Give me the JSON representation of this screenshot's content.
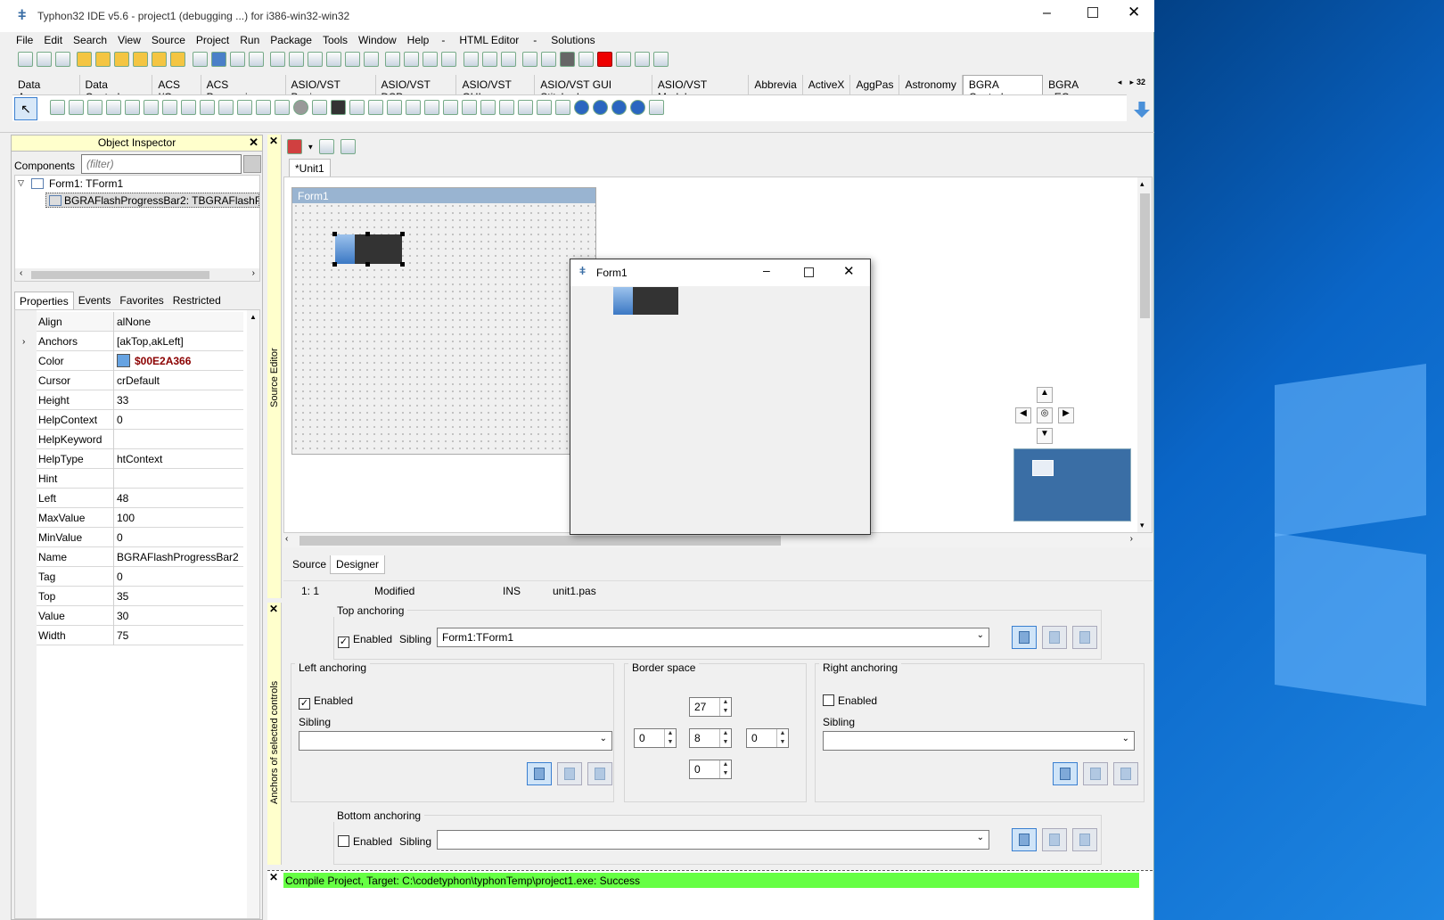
{
  "title": "Typhon32 IDE v5.6 - project1 (debugging ...) for i386-win32-win32",
  "menu": [
    "File",
    "Edit",
    "Search",
    "View",
    "Source",
    "Project",
    "Run",
    "Package",
    "Tools",
    "Window",
    "Help",
    "-",
    "HTML Editor",
    "-",
    "Solutions"
  ],
  "palette_tabs": [
    "Data Access",
    "Data Controls",
    "ACS I/O",
    "ACS Processing",
    "ASIO/VST Basics",
    "ASIO/VST DSP",
    "ASIO/VST GUI",
    "ASIO/VST GUI Stitched",
    "ASIO/VST Modular",
    "Abbrevia",
    "ActiveX",
    "AggPas",
    "Astronomy",
    "BGRA Controls",
    "BGRA uECon"
  ],
  "palette_badge": "32",
  "inspector": {
    "title": "Object Inspector",
    "components_label": "Components",
    "filter_placeholder": "(filter)",
    "tree_root": "Form1: TForm1",
    "tree_child": "BGRAFlashProgressBar2: TBGRAFlashProgr",
    "tabs": [
      "Properties",
      "Events",
      "Favorites",
      "Restricted"
    ],
    "props": [
      [
        "Align",
        "alNone"
      ],
      [
        "Anchors",
        "[akTop,akLeft]"
      ],
      [
        "Color",
        "$00E2A366"
      ],
      [
        "Cursor",
        "crDefault"
      ],
      [
        "Height",
        "33"
      ],
      [
        "HelpContext",
        "0"
      ],
      [
        "HelpKeyword",
        ""
      ],
      [
        "HelpType",
        "htContext"
      ],
      [
        "Hint",
        ""
      ],
      [
        "Left",
        "48"
      ],
      [
        "MaxValue",
        "100"
      ],
      [
        "MinValue",
        "0"
      ],
      [
        "Name",
        "BGRAFlashProgressBar2"
      ],
      [
        "Tag",
        "0"
      ],
      [
        "Top",
        "35"
      ],
      [
        "Value",
        "30"
      ],
      [
        "Width",
        "75"
      ]
    ],
    "color_value": "$00E2A366"
  },
  "editor": {
    "vertical_label": "Source Editor",
    "tab": "*Unit1",
    "design_form_title": "Form1",
    "bottom_tabs": [
      "Source",
      "Designer"
    ],
    "status": {
      "pos": "1: 1",
      "modified": "Modified",
      "mode": "INS",
      "file": "unit1.pas"
    }
  },
  "runtime_form": {
    "title": "Form1",
    "progress": 0.3
  },
  "anchors": {
    "vertical_label": "Anchors of selected controls",
    "top": {
      "label": "Top anchoring",
      "enabled_label": "Enabled",
      "sibling_label": "Sibling",
      "sibling_value": "Form1:TForm1",
      "checked": true
    },
    "left": {
      "label": "Left anchoring",
      "enabled_label": "Enabled",
      "sibling_label": "Sibling",
      "sibling_value": "",
      "checked": true
    },
    "border": {
      "label": "Border space",
      "top": "27",
      "left": "0",
      "center": "8",
      "right": "0",
      "bottom": "0"
    },
    "right": {
      "label": "Right anchoring",
      "enabled_label": "Enabled",
      "sibling_label": "Sibling",
      "sibling_value": "",
      "checked": false
    },
    "bottom": {
      "label": "Bottom anchoring",
      "enabled_label": "Enabled",
      "sibling_label": "Sibling",
      "sibling_value": "",
      "checked": false
    }
  },
  "messages": {
    "compile": "Compile Project, Target: C:\\codetyphon\\typhonTemp\\project1.exe: Success"
  },
  "colors": {
    "accent": "#0078d7",
    "success": "#66ff44",
    "form_caption": "#99b4d1",
    "selected": "#3a6ea5"
  }
}
